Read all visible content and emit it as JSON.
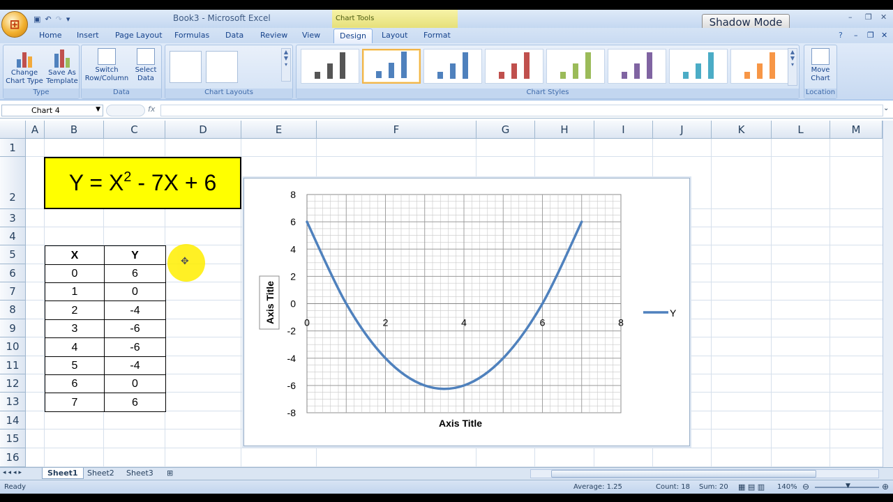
{
  "title": {
    "window_title": "Book3 - Microsoft Excel",
    "context_tab": "Chart Tools",
    "shadow_mode": "Shadow Mode"
  },
  "ribbon_tabs": [
    {
      "label": "Home"
    },
    {
      "label": "Insert"
    },
    {
      "label": "Page Layout"
    },
    {
      "label": "Formulas"
    },
    {
      "label": "Data"
    },
    {
      "label": "Review"
    },
    {
      "label": "View"
    },
    {
      "label": "Design"
    },
    {
      "label": "Layout"
    },
    {
      "label": "Format"
    }
  ],
  "ribbon": {
    "change_type_l1": "Change",
    "change_type_l2": "Chart Type",
    "save_template_l1": "Save As",
    "save_template_l2": "Template",
    "type_group": "Type",
    "switch_l1": "Switch",
    "switch_l2": "Row/Column",
    "select_l1": "Select",
    "select_l2": "Data",
    "data_group": "Data",
    "layouts_group": "Chart Layouts",
    "styles_group": "Chart Styles",
    "move_l1": "Move",
    "move_l2": "Chart",
    "location_group": "Location",
    "style_colors": [
      "#555555",
      "#4f81bd",
      "#4f81bd",
      "#c0504d",
      "#9bbb59",
      "#8064a2",
      "#4bacc6",
      "#f79646"
    ]
  },
  "formula_bar": {
    "name_box": "Chart 4",
    "fx": "fx",
    "formula": ""
  },
  "columns": [
    "A",
    "B",
    "C",
    "D",
    "E",
    "F",
    "G",
    "H",
    "I",
    "J",
    "K",
    "L",
    "M"
  ],
  "rows": [
    "1",
    "2",
    "3",
    "4",
    "5",
    "6",
    "7",
    "8",
    "9",
    "10",
    "11",
    "12",
    "13",
    "14",
    "15",
    "16"
  ],
  "equation": {
    "prefix": "Y = X",
    "exponent": "2",
    "suffix": " - 7X + 6"
  },
  "table": {
    "headers": [
      "X",
      "Y"
    ],
    "rows": [
      [
        "0",
        "6"
      ],
      [
        "1",
        "0"
      ],
      [
        "2",
        "-4"
      ],
      [
        "3",
        "-6"
      ],
      [
        "4",
        "-6"
      ],
      [
        "5",
        "-4"
      ],
      [
        "6",
        "0"
      ],
      [
        "7",
        "6"
      ]
    ]
  },
  "chart_data": {
    "type": "scatter",
    "title": "",
    "xlabel": "Axis Title",
    "ylabel": "Axis Title",
    "xlim": [
      0,
      8
    ],
    "ylim": [
      -8,
      8
    ],
    "x_ticks": [
      "0",
      "2",
      "4",
      "6",
      "8"
    ],
    "y_ticks": [
      "8",
      "6",
      "4",
      "2",
      "0",
      "-2",
      "-4",
      "-6",
      "-8"
    ],
    "grid": true,
    "legend_position": "right",
    "smooth_line": true,
    "series": [
      {
        "name": "Y",
        "color": "#4f81bd",
        "x": [
          0,
          1,
          2,
          3,
          4,
          5,
          6,
          7
        ],
        "y": [
          6,
          0,
          -4,
          -6,
          -6,
          -4,
          0,
          6
        ]
      }
    ]
  },
  "sheets": [
    {
      "label": "Sheet1"
    },
    {
      "label": "Sheet2"
    },
    {
      "label": "Sheet3"
    }
  ],
  "status": {
    "ready": "Ready",
    "average": "Average: 1.25",
    "count": "Count: 18",
    "sum": "Sum: 20",
    "zoom": "140%"
  }
}
